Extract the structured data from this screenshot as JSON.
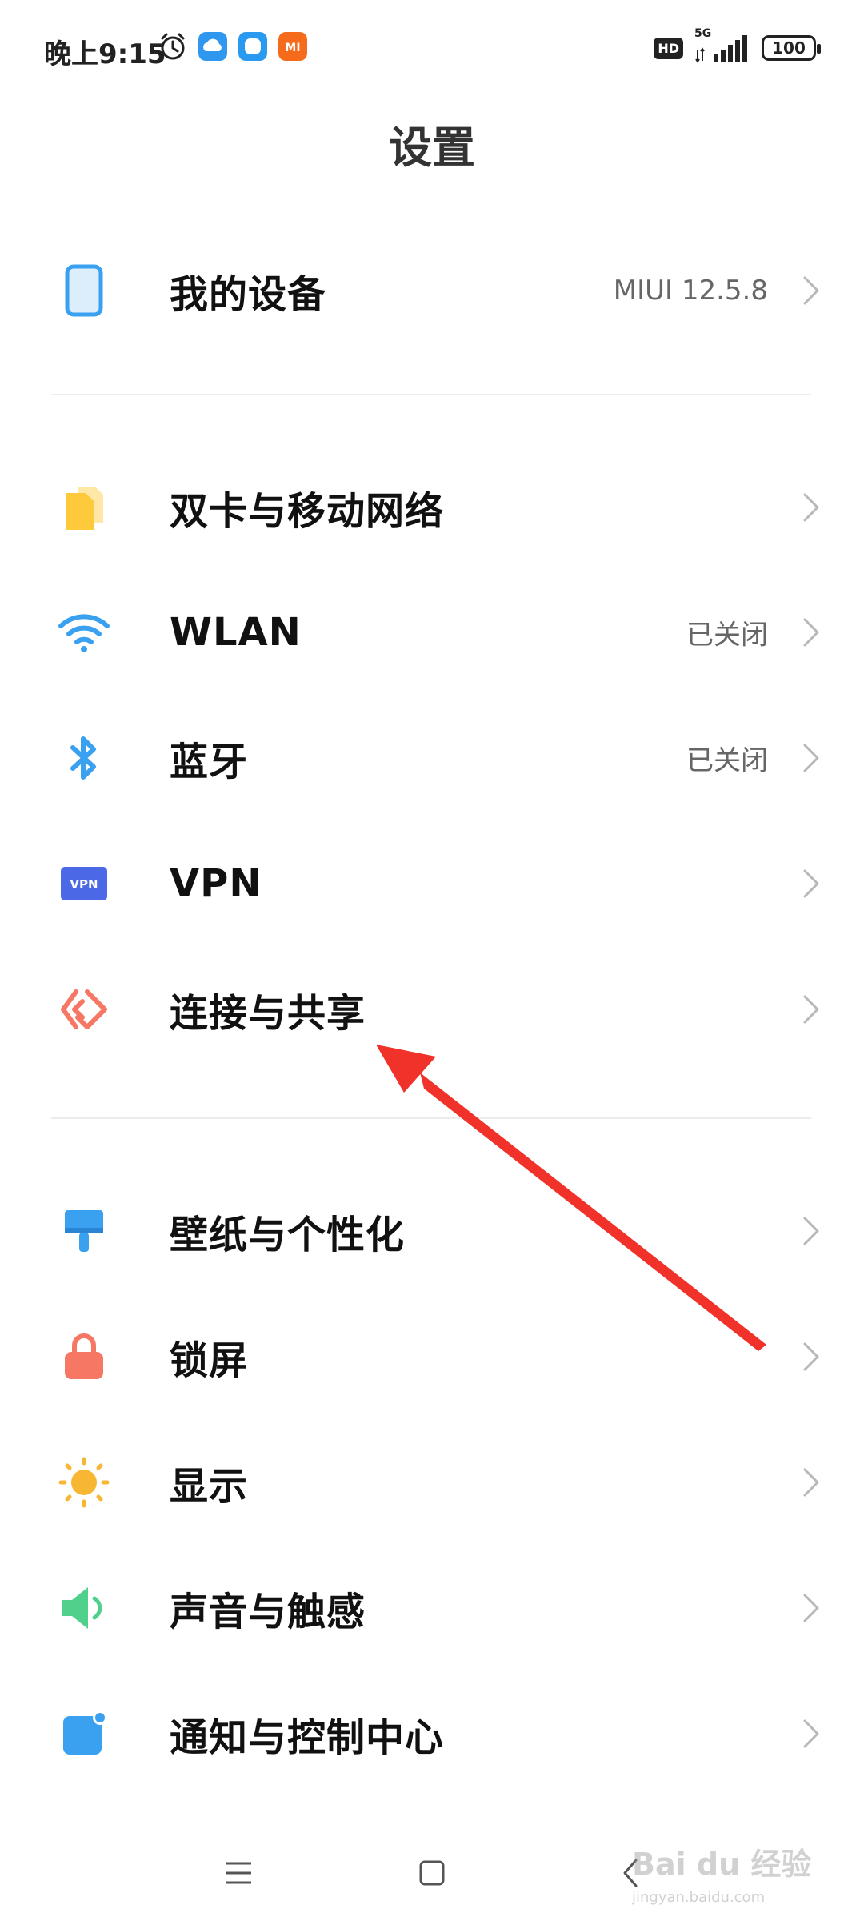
{
  "status_bar": {
    "time": "晚上9:15",
    "hd": "HD",
    "network": "5G",
    "battery": "100"
  },
  "page": {
    "title": "设置"
  },
  "sections": {
    "device": {
      "label": "我的设备",
      "value": "MIUI 12.5.8"
    },
    "network": [
      {
        "label": "双卡与移动网络",
        "value": ""
      },
      {
        "label": "WLAN",
        "value": "已关闭"
      },
      {
        "label": "蓝牙",
        "value": "已关闭"
      },
      {
        "label": "VPN",
        "value": ""
      },
      {
        "label": "连接与共享",
        "value": ""
      }
    ],
    "personal": [
      {
        "label": "壁纸与个性化",
        "value": ""
      },
      {
        "label": "锁屏",
        "value": ""
      },
      {
        "label": "显示",
        "value": ""
      },
      {
        "label": "声音与触感",
        "value": ""
      },
      {
        "label": "通知与控制中心",
        "value": ""
      }
    ]
  },
  "icons": {
    "vpn_text": "VPN",
    "mi_text": "MI"
  },
  "colors": {
    "accent_blue": "#3aa0f0",
    "sim_yellow": "#ffc93c",
    "arrow_red": "#f0322a",
    "lock_red": "#f57764",
    "sun_yellow": "#f7b733",
    "sound_green": "#4fd08b",
    "vpn_indigo": "#4b68e6"
  },
  "watermark": {
    "brand": "Bai du 经验",
    "url": "jingyan.baidu.com"
  }
}
